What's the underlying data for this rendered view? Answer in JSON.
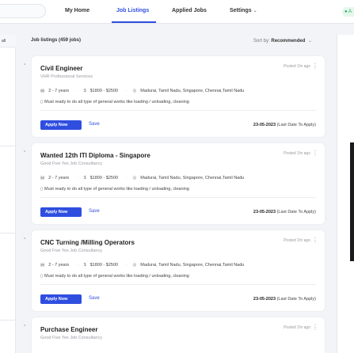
{
  "nav": {
    "items": [
      "My Home",
      "Job Listings",
      "Applied Jobs",
      "Settings"
    ],
    "settings_chevron": "chevron-down-icon",
    "status": "A",
    "status_color": "#2aa85a"
  },
  "accent_color": "#2f4ee0",
  "sidebar": {
    "tab_label": "all"
  },
  "listing": {
    "header": "Job listings (459 jobs)",
    "sort_label": "Sort by:",
    "sort_value": "Recommended"
  },
  "jobs": [
    {
      "title": "Civil Engineer",
      "company": "VHR Professional Services",
      "posted": "Posted 1hr ago",
      "experience": "2 - 7 years",
      "salary": "$1800 - $2500",
      "location": "Madurai, Tamil Nadu, Singapore, Chennai,Tamil Nadu",
      "task": "Must ready to do all type of general works like loading / unloading, cleaning",
      "apply_label": "Apply Now",
      "save_label": "Save",
      "deadline_date": "23-05-2023",
      "deadline_note": "(Last Date To Apply)"
    },
    {
      "title": "Wanted 12th ITI Diploma - Singapore",
      "company": "Good Five Yes Job Consultancy",
      "posted": "Posted 1hr ago",
      "experience": "2 - 7 years",
      "salary": "$1800 - $2500",
      "location": "Madurai, Tamil Nadu, Singapore, Chennai,Tamil Nadu",
      "task": "Must ready to do all type of general works like loading / unloading, cleaning",
      "apply_label": "Apply Now",
      "save_label": "Save",
      "deadline_date": "23-05-2023",
      "deadline_note": "(Last Date To Apply)"
    },
    {
      "title": "CNC Turning /Milling Operators",
      "company": "Good Five Yes Job Consultancy",
      "posted": "Posted 1hr ago",
      "experience": "2 - 7 years",
      "salary": "$1800 - $2500",
      "location": "Madurai, Tamil Nadu, Singapore, Chennai,Tamil Nadu",
      "task": "Must ready to do all type of general works like loading / unloading, cleaning",
      "apply_label": "Apply Now",
      "save_label": "Save",
      "deadline_date": "23-05-2023",
      "deadline_note": "(Last Date To Apply)"
    },
    {
      "title": "Purchase Engineer",
      "company": "Good Five Yes Job Consultancy",
      "posted": "Posted 1hr ago"
    }
  ],
  "icons": {
    "experience": "briefcase-icon",
    "salary": "dollar-icon",
    "location": "location-pin-icon",
    "task": "document-icon",
    "menu": "more-vertical-icon"
  }
}
